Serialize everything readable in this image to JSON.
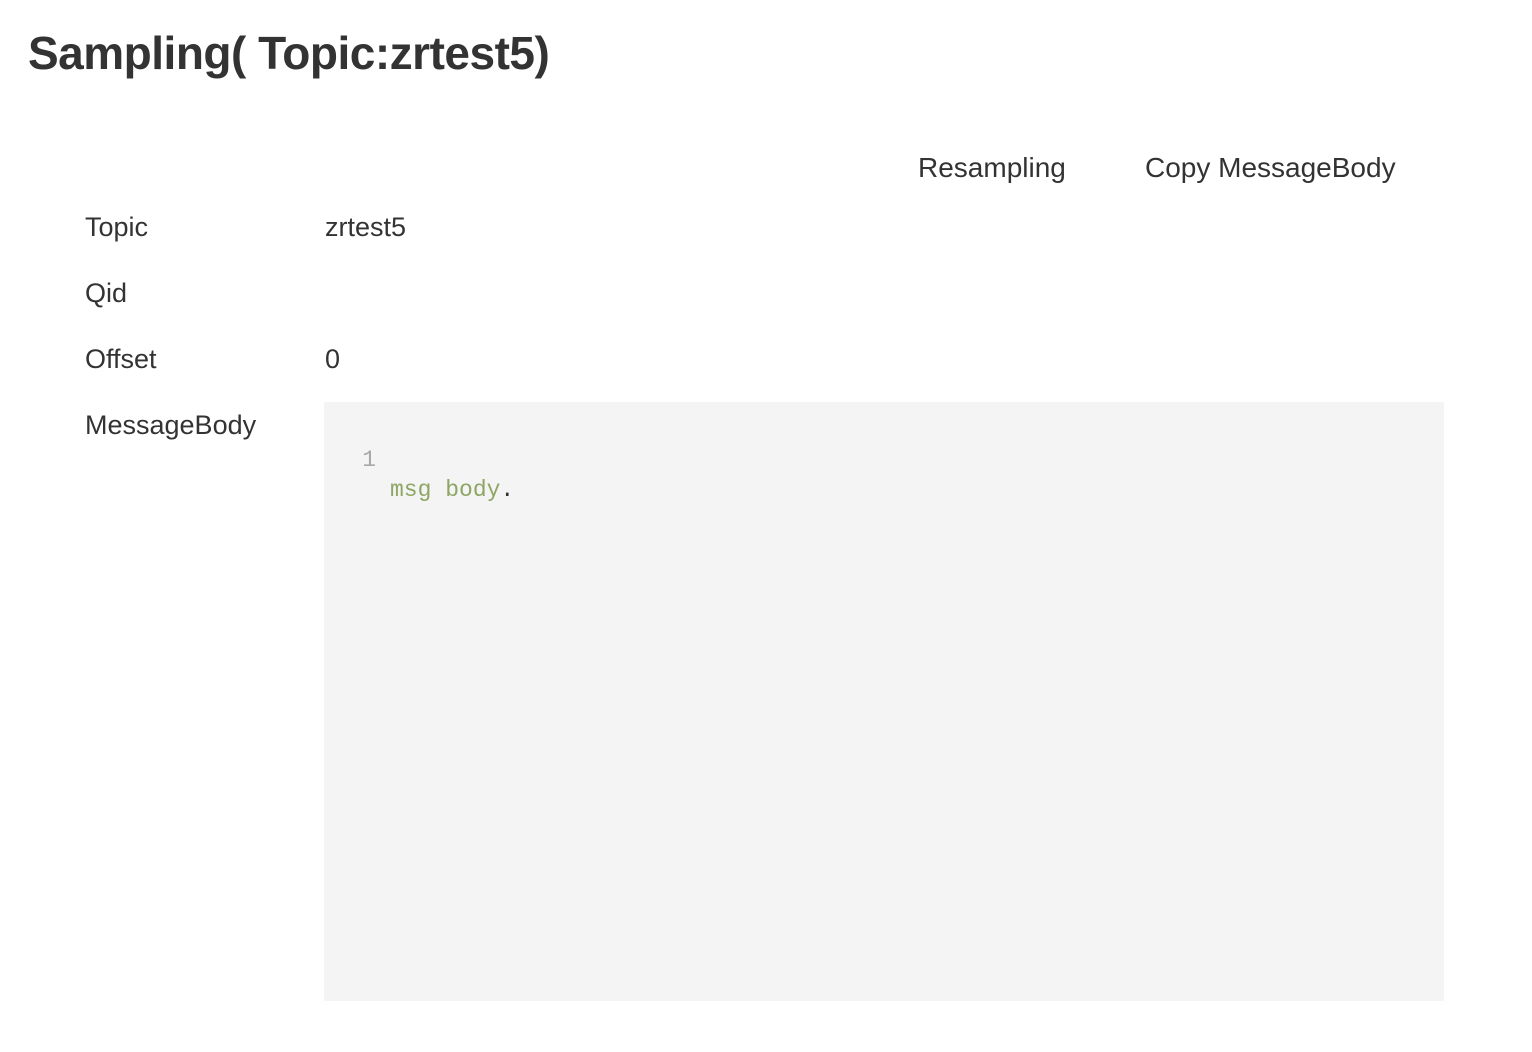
{
  "page": {
    "title": "Sampling( Topic:zrtest5)"
  },
  "toolbar": {
    "resample_label": "Resampling",
    "copy_label": "Copy MessageBody"
  },
  "fields": {
    "topic": {
      "label": "Topic",
      "value": "zrtest5"
    },
    "qid": {
      "label": "Qid",
      "value": ""
    },
    "offset": {
      "label": "Offset",
      "value": "0"
    },
    "body": {
      "label": "MessageBody"
    }
  },
  "editor": {
    "lines": [
      {
        "number": "1",
        "text": "msg body",
        "punct": "."
      }
    ]
  },
  "colors": {
    "text": "#333333",
    "editor_bg": "#f4f4f4",
    "code_string": "#8ea664",
    "line_number": "#a8a8a8"
  }
}
